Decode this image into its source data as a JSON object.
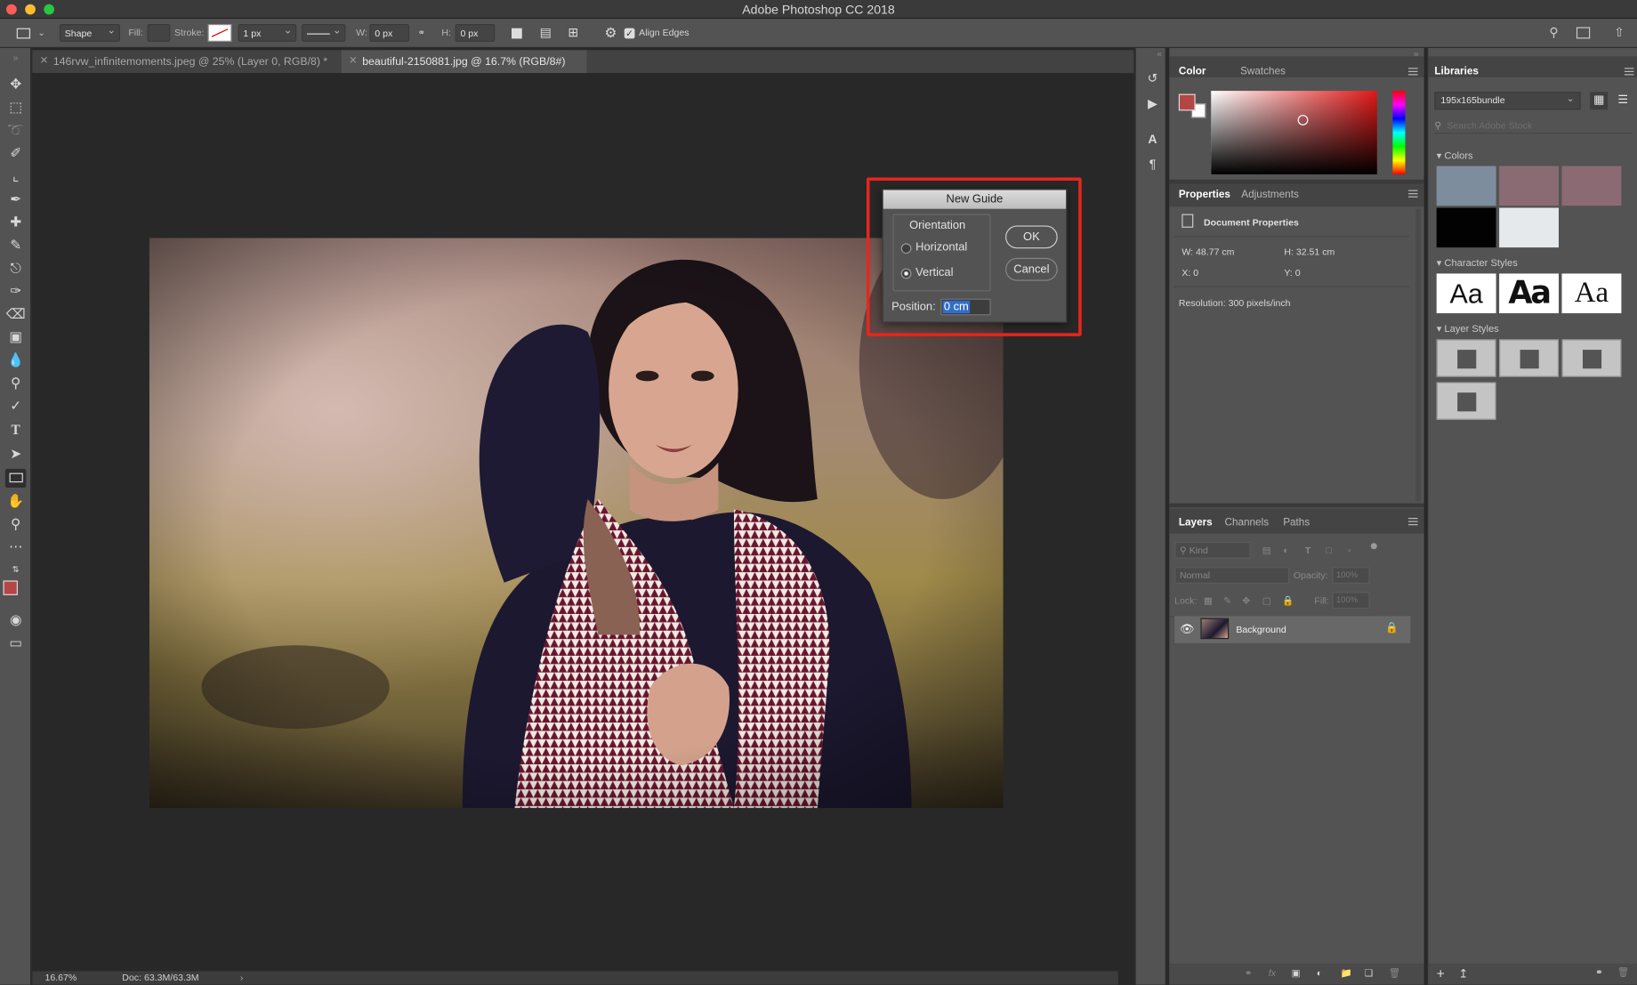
{
  "window": {
    "title": "Adobe Photoshop CC 2018"
  },
  "options_bar": {
    "mode": "Shape",
    "fill_label": "Fill:",
    "stroke_label": "Stroke:",
    "stroke_width": "1 px",
    "w_label": "W:",
    "w_value": "0 px",
    "h_label": "H:",
    "h_value": "0 px",
    "align_edges": "Align Edges"
  },
  "tabs": [
    {
      "label": "146rvw_infinitemoments.jpeg @ 25% (Layer 0, RGB/8) *",
      "active": false
    },
    {
      "label": "beautiful-2150881.jpg @ 16.7% (RGB/8#)",
      "active": true
    }
  ],
  "status": {
    "zoom": "16.67%",
    "doc": "Doc: 63.3M/63.3M"
  },
  "dialog": {
    "title": "New Guide",
    "orientation_label": "Orientation",
    "horizontal": "Horizontal",
    "vertical": "Vertical",
    "selected": "Vertical",
    "position_label": "Position:",
    "position_value": "0 cm",
    "ok": "OK",
    "cancel": "Cancel",
    "highlight_color": "#e8261c"
  },
  "color_panel": {
    "tabs": [
      "Color",
      "Swatches"
    ],
    "foreground": "#b44646",
    "hue": "#e01818"
  },
  "properties_panel": {
    "tabs": [
      "Properties",
      "Adjustments"
    ],
    "heading": "Document Properties",
    "w": "W: 48.77 cm",
    "h": "H: 32.51 cm",
    "x": "X: 0",
    "y": "Y: 0",
    "resolution": "Resolution: 300 pixels/inch"
  },
  "layers_panel": {
    "tabs": [
      "Layers",
      "Channels",
      "Paths"
    ],
    "kind": "Kind",
    "blend": "Normal",
    "opacity_label": "Opacity:",
    "opacity_value": "100%",
    "lock_label": "Lock:",
    "fill_label": "Fill:",
    "fill_value": "100%",
    "layer_name": "Background"
  },
  "libraries_panel": {
    "tab": "Libraries",
    "library": "195x165bundle",
    "search_placeholder": "Search Adobe Stock",
    "colors_title": "Colors",
    "swatches": [
      "#7e8d9e",
      "#8b6b73",
      "#8b6a74",
      "#020202",
      "#e6e9ec"
    ],
    "char_styles_title": "Character Styles",
    "char_styles": [
      "Aa",
      "Aa",
      "Aa"
    ],
    "layer_styles_title": "Layer Styles"
  }
}
